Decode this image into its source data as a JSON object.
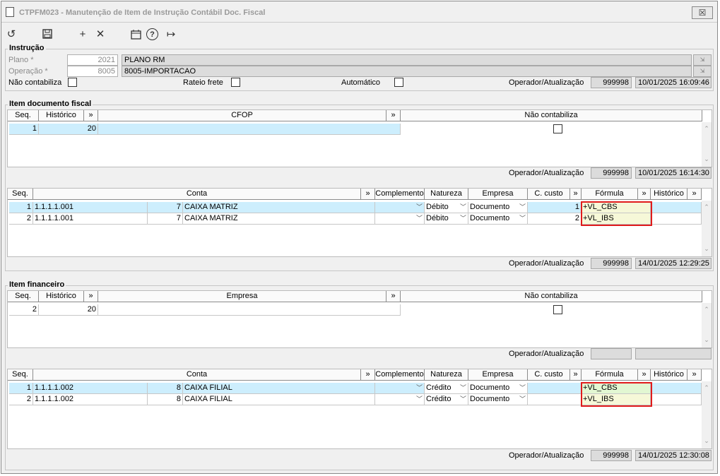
{
  "window": {
    "title": "CTPFM023 - Manutenção de Item de Instrução Contábil Doc. Fiscal",
    "close_label": "☒"
  },
  "toolbar": {
    "refresh_icon": "refresh-icon",
    "save_icon": "save-icon",
    "add_label": "+",
    "delete_label": "✕",
    "calendar_icon": "calendar-icon",
    "help_label": "?",
    "exit_icon": "exit-icon"
  },
  "instrucao": {
    "legend": "Instrução",
    "plano_label": "Plano *",
    "plano_code": "2021",
    "plano_name": "PLANO RM",
    "operacao_label": "Operação *",
    "operacao_code": "8005",
    "operacao_name": "8005-IMPORTACAO",
    "nao_contabiliza_label": "Não contabiliza",
    "rateio_label": "Rateio frete",
    "automatico_label": "Automático",
    "operador_label": "Operador/Atualização",
    "operador": "999998",
    "atualizacao": "10/01/2025 16:09:46"
  },
  "item_doc": {
    "legend": "Item documento fiscal",
    "headers": {
      "seq": "Seq.",
      "historico": "Histórico",
      "expand": "»",
      "cfop": "CFOP",
      "expand2": "»",
      "nao_contabiliza": "Não contabiliza"
    },
    "row": {
      "seq": "1",
      "historico": "20",
      "cfop": ""
    },
    "operador_label": "Operador/Atualização",
    "operador": "999998",
    "atualizacao": "10/01/2025 16:14:30"
  },
  "contas_doc": {
    "headers": {
      "seq": "Seq.",
      "conta": "Conta",
      "expand": "»",
      "complemento": "Complemento",
      "natureza": "Natureza",
      "empresa": "Empresa",
      "ccusto": "C. custo",
      "expand2": "»",
      "formula": "Fórmula",
      "expand3": "»",
      "historico": "Histórico",
      "expand4": "»"
    },
    "rows": [
      {
        "seq": "1",
        "conta": "1.1.1.1.001",
        "num": "7",
        "nome": "CAIXA MATRIZ",
        "natureza": "Débito",
        "empresa": "Documento",
        "ccusto": "1",
        "formula": "+VL_CBS"
      },
      {
        "seq": "2",
        "conta": "1.1.1.1.001",
        "num": "7",
        "nome": "CAIXA MATRIZ",
        "natureza": "Débito",
        "empresa": "Documento",
        "ccusto": "2",
        "formula": "+VL_IBS"
      }
    ],
    "operador_label": "Operador/Atualização",
    "operador": "999998",
    "atualizacao": "14/01/2025 12:29:25"
  },
  "item_fin": {
    "legend": "Item financeiro",
    "headers": {
      "seq": "Seq.",
      "historico": "Histórico",
      "expand": "»",
      "empresa": "Empresa",
      "expand2": "»",
      "nao_contabiliza": "Não contabiliza"
    },
    "row": {
      "seq": "2",
      "historico": "20",
      "empresa": ""
    },
    "operador_label": "Operador/Atualização",
    "operador": "",
    "atualizacao": ""
  },
  "contas_fin": {
    "headers": {
      "seq": "Seq.",
      "conta": "Conta",
      "expand": "»",
      "complemento": "Complemento",
      "natureza": "Natureza",
      "empresa": "Empresa",
      "ccusto": "C. custo",
      "expand2": "»",
      "formula": "Fórmula",
      "expand3": "»",
      "historico": "Histórico",
      "expand4": "»"
    },
    "rows": [
      {
        "seq": "1",
        "conta": "1.1.1.1.002",
        "num": "8",
        "nome": "CAIXA FILIAL",
        "natureza": "Crédito",
        "empresa": "Documento",
        "ccusto": "",
        "formula": "+VL_CBS"
      },
      {
        "seq": "2",
        "conta": "1.1.1.1.002",
        "num": "8",
        "nome": "CAIXA FILIAL",
        "natureza": "Crédito",
        "empresa": "Documento",
        "ccusto": "",
        "formula": "+VL_IBS"
      }
    ],
    "operador_label": "Operador/Atualização",
    "operador": "999998",
    "atualizacao": "14/01/2025 12:30:08"
  },
  "colors": {
    "selection": "#cdeefd",
    "formula_bg": "#f6f8d8",
    "highlight": "#e01b1b"
  }
}
